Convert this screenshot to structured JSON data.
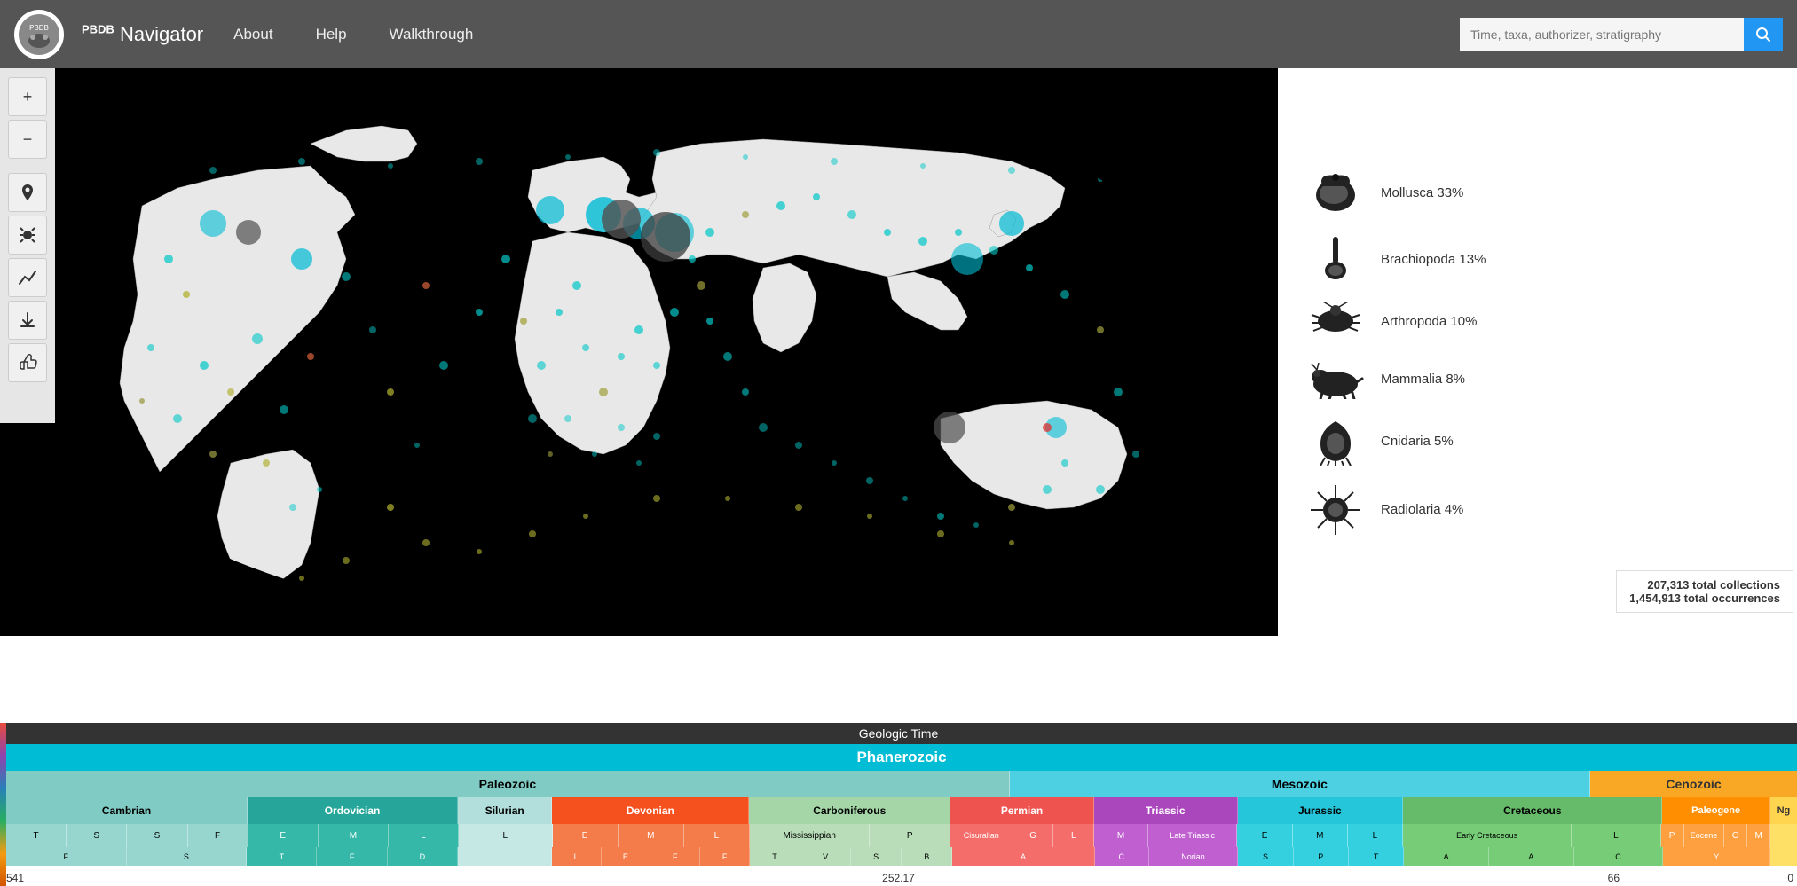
{
  "header": {
    "logo_alt": "PBDB Logo",
    "app_title": "Navigator",
    "app_title_prefix": "PBDB",
    "nav": [
      {
        "label": "About",
        "id": "about"
      },
      {
        "label": "Help",
        "id": "help"
      },
      {
        "label": "Walkthrough",
        "id": "walkthrough"
      }
    ],
    "search_placeholder": "Time, taxa, authorizer, stratigraphy"
  },
  "toolbar": {
    "buttons": [
      {
        "id": "zoom-in",
        "icon": "+",
        "label": "Zoom In"
      },
      {
        "id": "zoom-out",
        "icon": "−",
        "label": "Zoom Out"
      },
      {
        "id": "filter",
        "icon": "🌍",
        "label": "Filter by location"
      },
      {
        "id": "bug",
        "icon": "🐛",
        "label": "Bug report"
      },
      {
        "id": "chart",
        "icon": "📈",
        "label": "View chart"
      },
      {
        "id": "download",
        "icon": "⬇",
        "label": "Download"
      },
      {
        "id": "feedback",
        "icon": "👍",
        "label": "Feedback"
      }
    ]
  },
  "taxa_legend": [
    {
      "label": "Mollusca 33%",
      "icon_type": "mollusca"
    },
    {
      "label": "Brachiopoda 13%",
      "icon_type": "brachiopoda"
    },
    {
      "label": "Arthropoda 10%",
      "icon_type": "arthropoda"
    },
    {
      "label": "Mammalia 8%",
      "icon_type": "mammalia"
    },
    {
      "label": "Cnidaria 5%",
      "icon_type": "cnidaria"
    },
    {
      "label": "Radiolaria 4%",
      "icon_type": "radiolaria"
    }
  ],
  "stats": {
    "collections": "207,313 total collections",
    "occurrences": "1,454,913 total occurrences"
  },
  "timeline": {
    "title": "Geologic Time",
    "eons": [
      {
        "label": "Phanerozoic"
      }
    ],
    "eras": [
      {
        "label": "Paleozoic"
      },
      {
        "label": "Mesozoic"
      },
      {
        "label": "Cenozoic"
      }
    ],
    "periods": [
      {
        "label": "Cambrian"
      },
      {
        "label": "Ordovician"
      },
      {
        "label": "Silurian"
      },
      {
        "label": "Devonian"
      },
      {
        "label": "Carboniferous"
      },
      {
        "label": "Permian"
      },
      {
        "label": "Triassic"
      },
      {
        "label": "Jurassic"
      },
      {
        "label": "Cretaceous"
      },
      {
        "label": "Paleogene"
      },
      {
        "label": "Ng"
      }
    ],
    "epochs_cambrian": [
      "T",
      "S",
      "S",
      "F"
    ],
    "epochs_ordovician": [
      "E",
      "M",
      "L"
    ],
    "epochs_silurian": [
      "L"
    ],
    "epochs_devonian": [
      "E",
      "M",
      "L"
    ],
    "epochs_carboniferous": [
      "Mississippian",
      "P"
    ],
    "epochs_permian": [
      "Cisuralian",
      "G",
      "L"
    ],
    "epochs_triassic": [
      "M",
      "Late Triassic"
    ],
    "epochs_jurassic": [
      "E",
      "M",
      "L"
    ],
    "epochs_cretaceous": [
      "Early Cretaceous",
      "L"
    ],
    "epochs_paleogene": [
      "P",
      "Eocene",
      "O",
      "M"
    ],
    "scale_marks": [
      {
        "value": "541",
        "position": "0%"
      },
      {
        "value": "252.17",
        "position": "52%"
      },
      {
        "value": "66",
        "position": "88%"
      },
      {
        "value": "0",
        "position": "99.5%"
      }
    ]
  }
}
